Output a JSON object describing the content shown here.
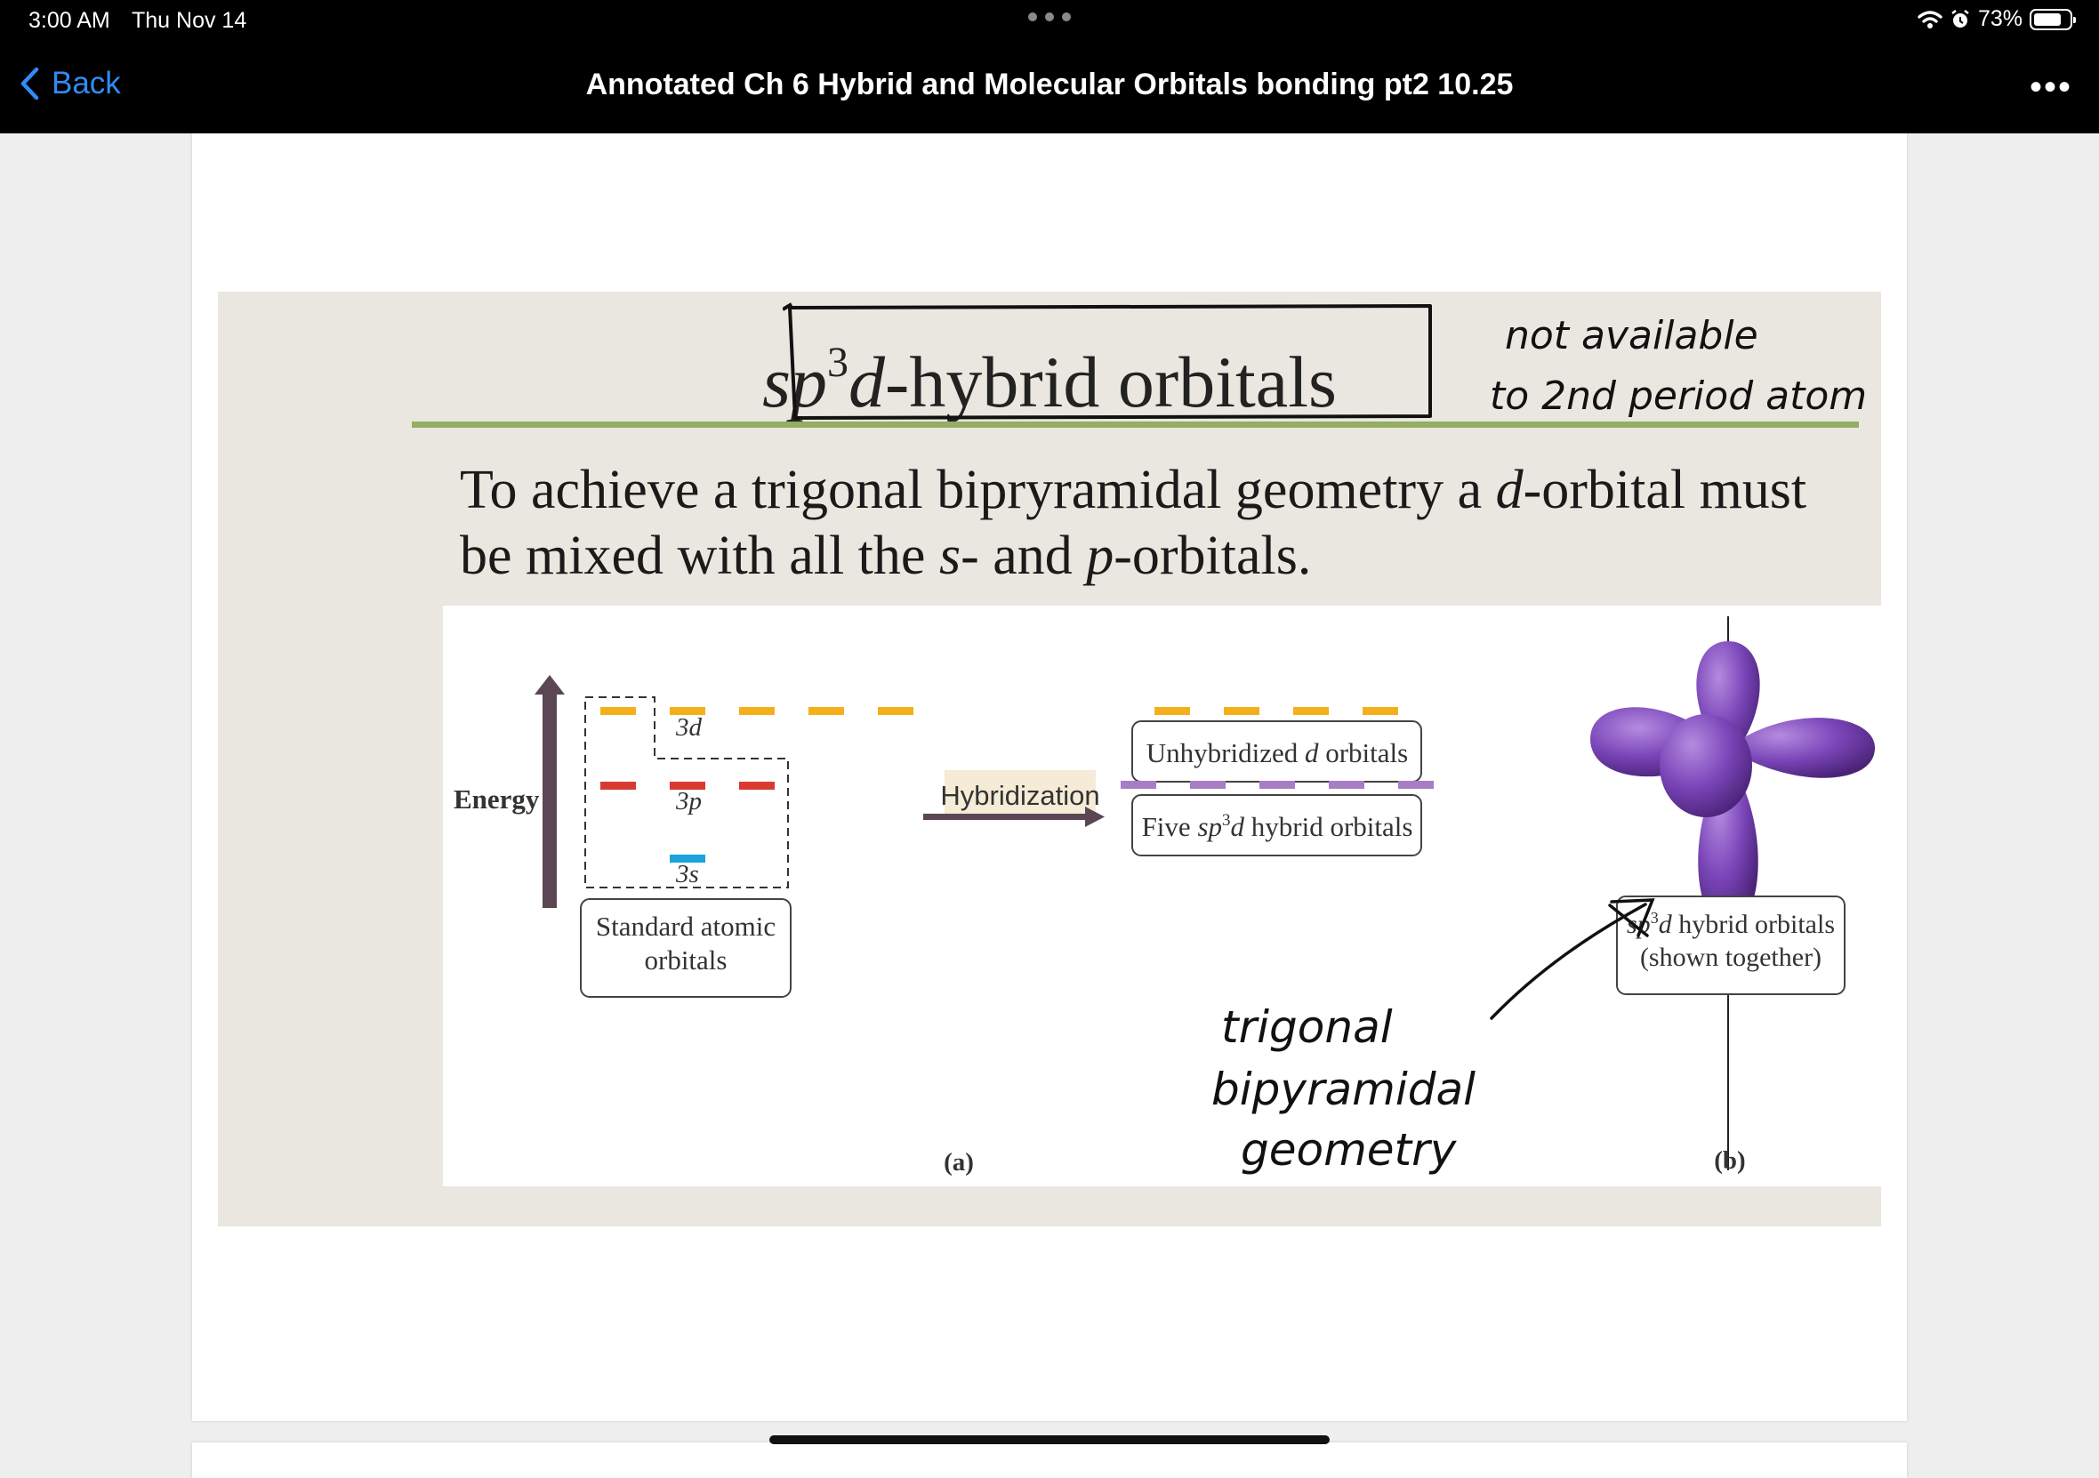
{
  "status_bar": {
    "time": "3:00 AM",
    "date": "Thu Nov 14",
    "battery": "73%"
  },
  "nav": {
    "back_label": "Back",
    "title": "Annotated Ch 6 Hybrid and Molecular Orbitals bonding pt2 10.25",
    "more_label": "•••"
  },
  "slide": {
    "title_italic": "sp",
    "title_sup": "3",
    "title_italic2": "d",
    "title_rest": "-hybrid orbitals",
    "body_a": "To achieve a trigonal bipryramidal geometry a ",
    "body_d": "d",
    "body_b": "-orbital must be mixed with all the ",
    "body_s": "s",
    "body_c": "- and ",
    "body_p": "p",
    "body_e": "-orbitals."
  },
  "figure": {
    "energy_label": "Energy",
    "label_3d": "3d",
    "label_3p": "3p",
    "label_3s": "3s",
    "standard_line1": "Standard atomic",
    "standard_line2": "orbitals",
    "hybridization_label": "Hybridization",
    "unhybridized_a": "Unhybridized ",
    "unhybridized_d": "d",
    "unhybridized_b": " orbitals",
    "five_a": "Five ",
    "five_sp": "sp",
    "five_sup": "3",
    "five_d": "d",
    "five_b": " hybrid orbitals",
    "caption_a": "(a)",
    "caption_b": "(b)",
    "shown_sp": "sp",
    "shown_sup": "3",
    "shown_d": "d",
    "shown_line1_rest": " hybrid orbitals",
    "shown_line2": "(shown together)"
  },
  "annotations": {
    "note_top_1": "not available",
    "note_top_2": "to 2nd period atom",
    "note_mid_1": "trigonal",
    "note_mid_2": "bipyramidal",
    "note_mid_3": "geometry"
  },
  "colors": {
    "orange_orbital": "#f4b01c",
    "red_orbital": "#d93a30",
    "blue_orbital": "#1aa3dc",
    "hybrid_orbital": "#a77dc4",
    "lobe_purple": "#7a45b8",
    "energy_arrow": "#5b4654",
    "slide_rule": "#94ad62",
    "back_blue": "#2f8cf5"
  }
}
